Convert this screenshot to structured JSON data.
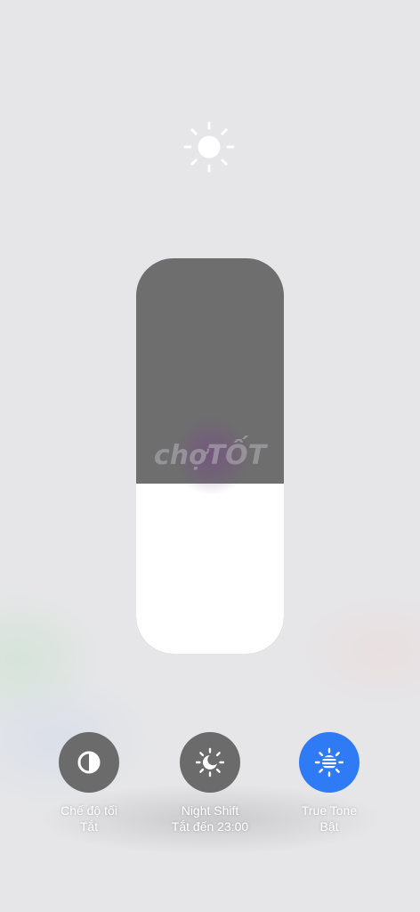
{
  "header": {
    "icon": "sun-icon"
  },
  "brightness": {
    "level_percent": 43
  },
  "watermark": {
    "text": "chợTỐT"
  },
  "controls": [
    {
      "icon": "dark-mode-icon",
      "label": "Chế độ tối",
      "status": "Tắt",
      "active": false
    },
    {
      "icon": "night-shift-icon",
      "label": "Night Shift",
      "status": "Tắt đến 23:00",
      "active": false
    },
    {
      "icon": "true-tone-icon",
      "label": "True Tone",
      "status": "Bật",
      "active": true
    }
  ],
  "colors": {
    "background": "#e6e6e8",
    "slider_track": "#6e6e6e",
    "slider_fill": "#ffffff",
    "button_inactive": "#6b6b6b",
    "button_active": "#2f7bf5",
    "label": "#ffffff"
  }
}
